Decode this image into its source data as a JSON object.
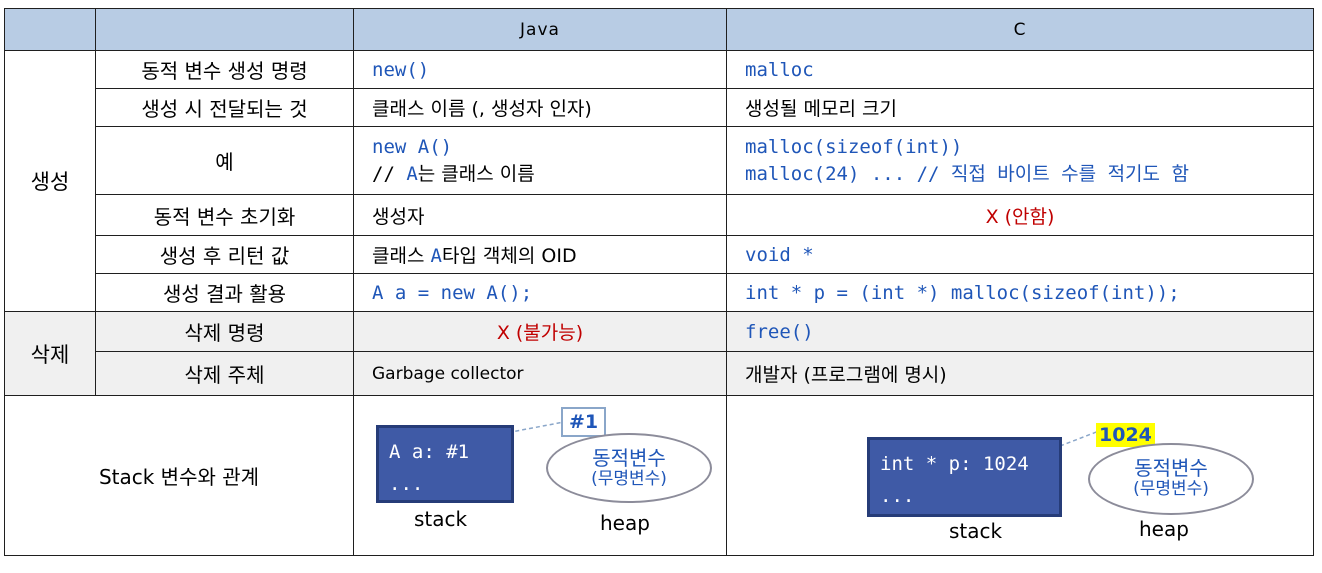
{
  "header": {
    "java": "Java",
    "c": "C"
  },
  "sections": {
    "create": "생성",
    "delete": "삭제"
  },
  "rows": {
    "cmd": {
      "label": "동적 변수 생성 명령",
      "java": "new()",
      "c": "malloc"
    },
    "pass": {
      "label": "생성 시 전달되는 것",
      "java": "클래스 이름 (, 생성자 인자)",
      "c": "생성될 메모리 크기"
    },
    "example": {
      "label": "예",
      "java_line1": "new A()",
      "java_line2_prefix": "// ",
      "java_line2_a": "A",
      "java_line2_rest": "는 클래스 이름",
      "c_line1": "malloc(sizeof(int))",
      "c_line2": "malloc(24) ... // 직접 바이트 수를 적기도 함"
    },
    "init": {
      "label": "동적 변수 초기화",
      "java": "생성자",
      "c": "X (안함)"
    },
    "ret": {
      "label": "생성 후 리턴 값",
      "java_prefix": "클래스 ",
      "java_a": "A",
      "java_rest": "타입 객체의 OID",
      "c": "void *"
    },
    "use": {
      "label": "생성 결과 활용",
      "java": "A a = new A();",
      "c": "int * p = (int *) malloc(sizeof(int));"
    },
    "del_cmd": {
      "label": "삭제 명령",
      "java": "X (불가능)",
      "c": "free()"
    },
    "del_who": {
      "label": "삭제 주체",
      "java": "Garbage collector",
      "c": "개발자 (프로그램에 명시)"
    },
    "stack": {
      "label": "Stack 변수와 관계",
      "java": {
        "var_line1": "A a: #1",
        "var_line2": "...",
        "address": "#1",
        "dyn": "동적변수",
        "anon": "(무명변수)",
        "stack_cap": "stack",
        "heap_cap": "heap"
      },
      "c": {
        "var_line1": "int * p: 1024",
        "var_line2": "...",
        "address": "1024",
        "dyn": "동적변수",
        "anon": "(무명변수)",
        "stack_cap": "stack",
        "heap_cap": "heap"
      }
    }
  }
}
